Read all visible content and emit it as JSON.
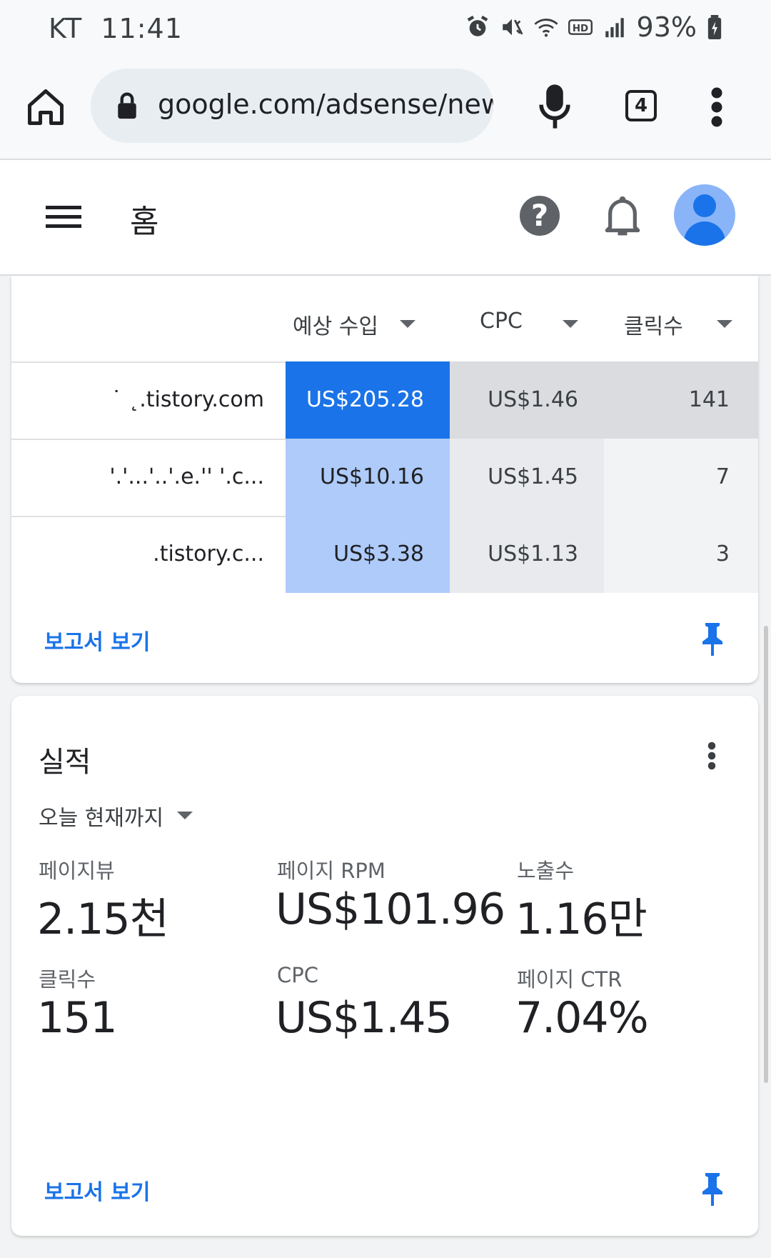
{
  "status_bar": {
    "carrier": "KT",
    "time": "11:41",
    "battery": "93%"
  },
  "browser": {
    "url": "google.com/adsense/new/",
    "tab_count": "4"
  },
  "app_header": {
    "title": "홈"
  },
  "sites_table": {
    "headers": {
      "earnings": "예상 수입",
      "cpc": "CPC",
      "clicks": "클릭수"
    },
    "rows": [
      {
        "site": "˙ ˛.tistory.com",
        "earnings": "US$205.28",
        "cpc": "US$1.46",
        "clicks": "141"
      },
      {
        "site": "'.'...'..'.e.'' '.c...",
        "earnings": "US$10.16",
        "cpc": "US$1.45",
        "clicks": "7"
      },
      {
        "site": ".tistory.c...",
        "earnings": "US$3.38",
        "cpc": "US$1.13",
        "clicks": "3"
      }
    ],
    "report_link": "보고서 보기"
  },
  "performance": {
    "title": "실적",
    "range": "오늘 현재까지",
    "metrics": [
      {
        "label": "페이지뷰",
        "value": "2.15천"
      },
      {
        "label": "페이지 RPM",
        "value": "US$101.96"
      },
      {
        "label": "노출수",
        "value": "1.16만"
      },
      {
        "label": "클릭수",
        "value": "151"
      },
      {
        "label": "CPC",
        "value": "US$1.45"
      },
      {
        "label": "페이지 CTR",
        "value": "7.04%"
      }
    ],
    "report_link": "보고서 보기"
  },
  "colors": {
    "accent": "#1a73e8",
    "heat_high": "#1a73e8",
    "heat_mid": "#aecbfa",
    "cell_gray_dark": "#dadce0",
    "cell_gray_light": "#f1f3f4"
  }
}
